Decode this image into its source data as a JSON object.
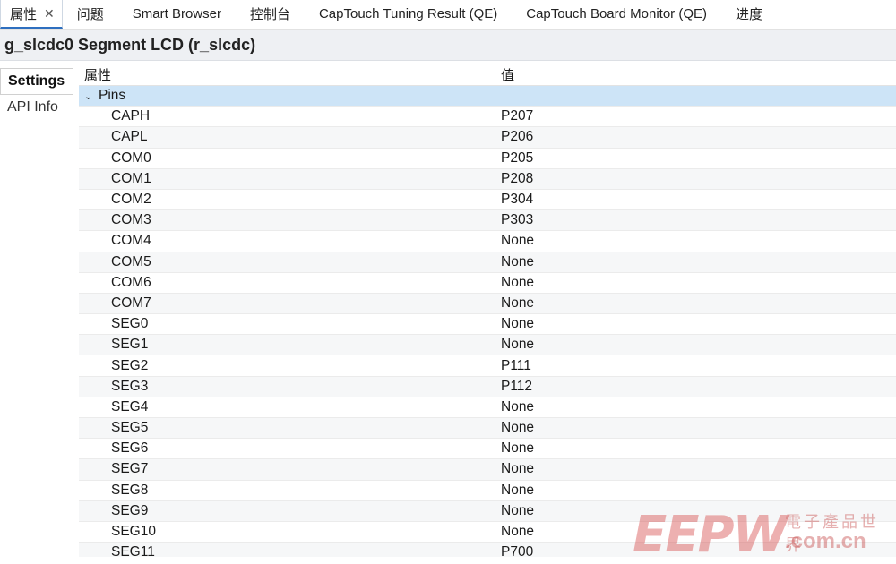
{
  "tabs": [
    {
      "label": "属性",
      "active": true,
      "closable": true
    },
    {
      "label": "问题"
    },
    {
      "label": "Smart Browser"
    },
    {
      "label": "控制台"
    },
    {
      "label": "CapTouch Tuning Result (QE)"
    },
    {
      "label": "CapTouch Board Monitor (QE)"
    },
    {
      "label": "进度"
    }
  ],
  "close_glyph": "✕",
  "title": "g_slcdc0 Segment LCD (r_slcdc)",
  "sidebar": {
    "items": [
      {
        "label": "Settings",
        "active": true
      },
      {
        "label": "API Info"
      }
    ]
  },
  "table": {
    "headers": {
      "property": "属性",
      "value": "值"
    },
    "group": {
      "label": "Pins",
      "expanded": true,
      "chevron": "⌄"
    },
    "rows": [
      {
        "property": "CAPH",
        "value": "P207"
      },
      {
        "property": "CAPL",
        "value": "P206"
      },
      {
        "property": "COM0",
        "value": "P205"
      },
      {
        "property": "COM1",
        "value": "P208"
      },
      {
        "property": "COM2",
        "value": "P304"
      },
      {
        "property": "COM3",
        "value": "P303"
      },
      {
        "property": "COM4",
        "value": "None"
      },
      {
        "property": "COM5",
        "value": "None"
      },
      {
        "property": "COM6",
        "value": "None"
      },
      {
        "property": "COM7",
        "value": "None"
      },
      {
        "property": "SEG0",
        "value": "None"
      },
      {
        "property": "SEG1",
        "value": "None"
      },
      {
        "property": "SEG2",
        "value": "P111"
      },
      {
        "property": "SEG3",
        "value": "P112"
      },
      {
        "property": "SEG4",
        "value": "None"
      },
      {
        "property": "SEG5",
        "value": "None"
      },
      {
        "property": "SEG6",
        "value": "None"
      },
      {
        "property": "SEG7",
        "value": "None"
      },
      {
        "property": "SEG8",
        "value": "None"
      },
      {
        "property": "SEG9",
        "value": "None"
      },
      {
        "property": "SEG10",
        "value": "None"
      },
      {
        "property": "SEG11",
        "value": "P700"
      }
    ]
  },
  "watermark": {
    "logo": "EEPW",
    "cn": "電子產品世界",
    "url": ".com.cn"
  },
  "colors": {
    "group_row": "#cde4f7",
    "active_tab_border": "#2e6fbf"
  }
}
